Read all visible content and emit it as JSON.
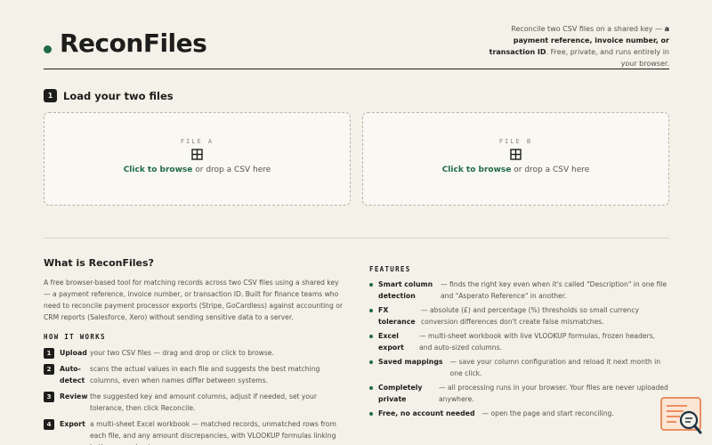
{
  "header": {
    "title": "ReconFiles",
    "tagline_pre": "Reconcile two CSV files on a shared key — ",
    "tagline_bold": "a payment reference, invoice number, or transaction ID",
    "tagline_post": ". Free, private, and runs entirely in your browser."
  },
  "load": {
    "step": "1",
    "title": "Load your two files",
    "file_a": {
      "label": "FILE A",
      "link": "Click to browse",
      "rest": " or drop a CSV here"
    },
    "file_b": {
      "label": "FILE B",
      "link": "Click to browse",
      "rest": " or drop a CSV here"
    }
  },
  "about": {
    "title": "What is ReconFiles?",
    "body": "A free browser-based tool for matching records across two CSV files using a shared key — a payment reference, invoice number, or transaction ID. Built for finance teams who need to reconcile payment processor exports (Stripe, GoCardless) against accounting or CRM reports (Salesforce, Xero) without sending sensitive data to a server.",
    "how_title": "HOW IT WORKS",
    "steps": [
      {
        "num": "1",
        "label": "Upload",
        "desc": "your two CSV files — drag and drop or click to browse."
      },
      {
        "num": "2",
        "label": "Auto-detect",
        "desc": "scans the actual values in each file and suggests the best matching columns, even when names differ between systems."
      },
      {
        "num": "3",
        "label": "Review",
        "desc": "the suggested key and amount columns, adjust if needed, set your tolerance, then click Reconcile."
      },
      {
        "num": "4",
        "label": "Export",
        "desc": "a multi-sheet Excel workbook — matched records, unmatched rows from each file, and any amount discrepancies, with VLOOKUP formulas linking both source sheets."
      }
    ]
  },
  "features": {
    "title": "FEATURES",
    "items": [
      {
        "label": "Smart column detection",
        "desc": "— finds the right key even when it's called \"Description\" in one file and \"Asperato Reference\" in another."
      },
      {
        "label": "FX tolerance",
        "desc": "— absolute (£) and percentage (%) thresholds so small currency conversion differences don't create false mismatches."
      },
      {
        "label": "Excel export",
        "desc": "— multi-sheet workbook with live VLOOKUP formulas, frozen headers, and auto-sized columns."
      },
      {
        "label": "Saved mappings",
        "desc": "— save your column configuration and reload it next month in one click."
      },
      {
        "label": "Completely private",
        "desc": "— all processing runs in your browser. Your files are never uploaded anywhere."
      },
      {
        "label": "Free, no account needed",
        "desc": "— open the page and start reconciling."
      }
    ]
  },
  "colors": {
    "accent": "#1f6b45",
    "background": "#f4f1e8",
    "widget": "#e8703a"
  },
  "icons": {
    "drop": "grid-plus-icon",
    "widget": "search-document-icon"
  }
}
